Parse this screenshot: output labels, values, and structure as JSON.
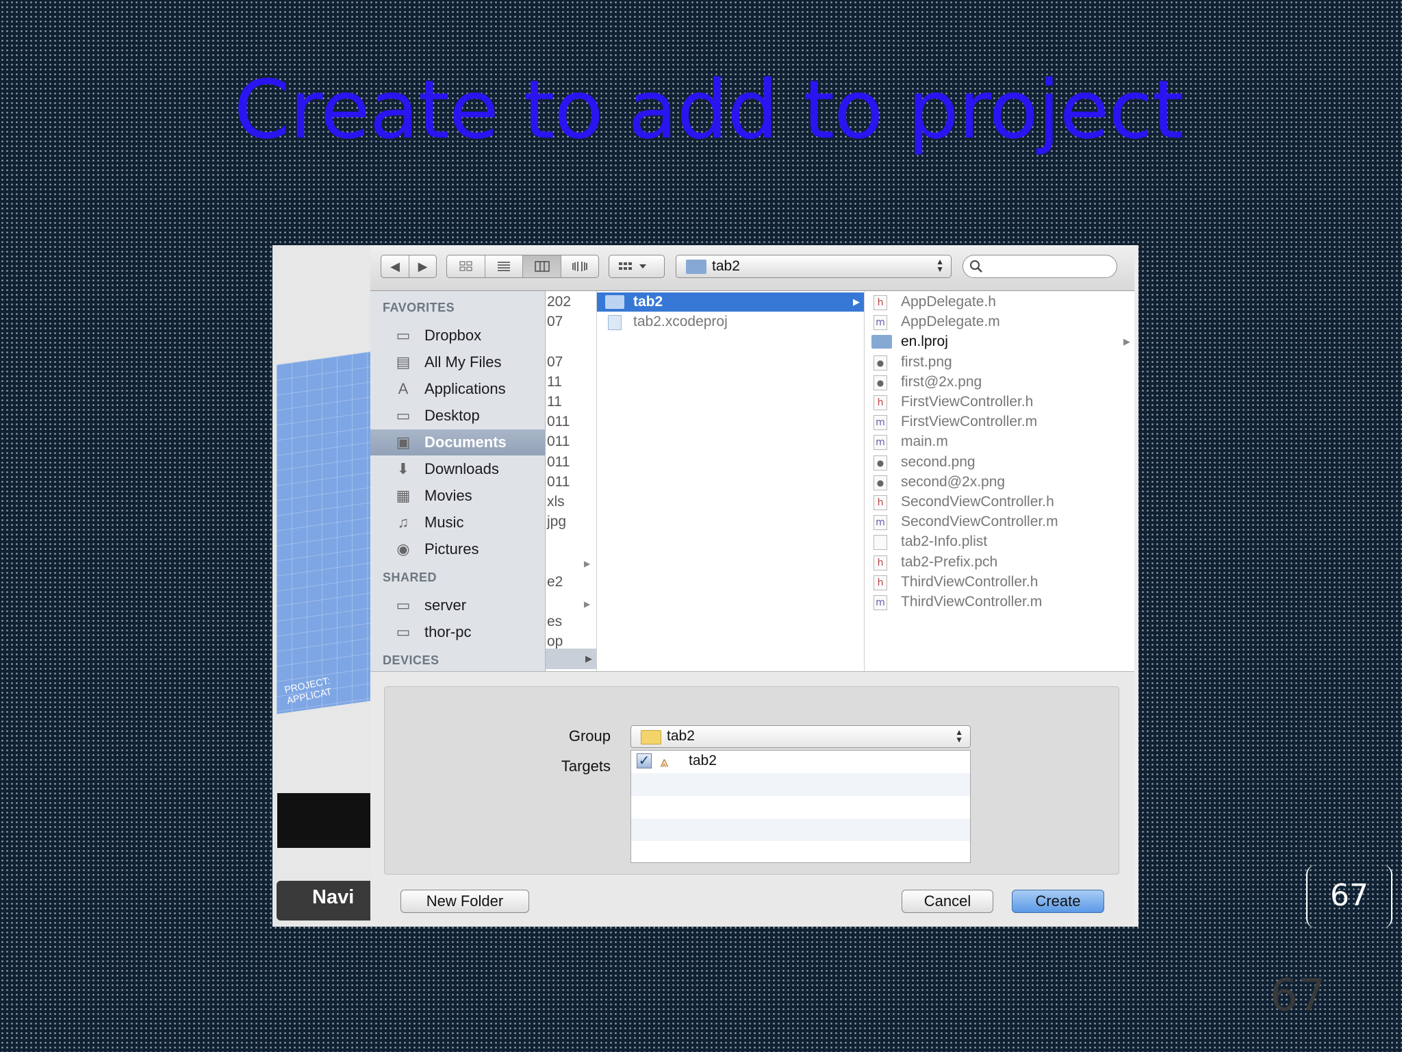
{
  "slide": {
    "title": "Create to add to project",
    "page_number": "67",
    "page_number_ghost": "67"
  },
  "background_app": {
    "nav_label": "Navi",
    "blueprint_label": "PROJECT: APPLICAT"
  },
  "toolbar": {
    "back_glyph": "◀",
    "forward_glyph": "▶",
    "path_popup": "tab2",
    "search_placeholder": ""
  },
  "sidebar": {
    "favorites_heading": "FAVORITES",
    "favorites": [
      {
        "label": "Dropbox",
        "icon": "folder-icon"
      },
      {
        "label": "All My Files",
        "icon": "all-files-icon"
      },
      {
        "label": "Applications",
        "icon": "applications-icon"
      },
      {
        "label": "Desktop",
        "icon": "desktop-icon"
      },
      {
        "label": "Documents",
        "icon": "documents-icon",
        "selected": true
      },
      {
        "label": "Downloads",
        "icon": "downloads-icon"
      },
      {
        "label": "Movies",
        "icon": "movies-icon"
      },
      {
        "label": "Music",
        "icon": "music-icon"
      },
      {
        "label": "Pictures",
        "icon": "pictures-icon"
      }
    ],
    "shared_heading": "SHARED",
    "shared": [
      {
        "label": "server",
        "icon": "computer-icon"
      },
      {
        "label": "thor-pc",
        "icon": "computer-icon"
      }
    ],
    "devices_heading": "DEVICES"
  },
  "column0": [
    "202",
    "07",
    "",
    "07",
    "11",
    "11",
    "011",
    "011",
    "011",
    "011",
    "xls",
    "jpg",
    "",
    "",
    "e2",
    "",
    "es",
    "op"
  ],
  "column1": [
    {
      "name": "tab2",
      "type": "folder",
      "selected": true
    },
    {
      "name": "tab2.xcodeproj",
      "type": "project"
    }
  ],
  "column2": [
    {
      "name": "AppDelegate.h",
      "kind": "h"
    },
    {
      "name": "AppDelegate.m",
      "kind": "m"
    },
    {
      "name": "en.lproj",
      "kind": "folder"
    },
    {
      "name": "first.png",
      "kind": "img"
    },
    {
      "name": "first@2x.png",
      "kind": "img"
    },
    {
      "name": "FirstViewController.h",
      "kind": "h"
    },
    {
      "name": "FirstViewController.m",
      "kind": "m"
    },
    {
      "name": "main.m",
      "kind": "m"
    },
    {
      "name": "second.png",
      "kind": "img"
    },
    {
      "name": "second@2x.png",
      "kind": "img"
    },
    {
      "name": "SecondViewController.h",
      "kind": "h"
    },
    {
      "name": "SecondViewController.m",
      "kind": "m"
    },
    {
      "name": "tab2-Info.plist",
      "kind": "plist"
    },
    {
      "name": "tab2-Prefix.pch",
      "kind": "h"
    },
    {
      "name": "ThirdViewController.h",
      "kind": "h"
    },
    {
      "name": "ThirdViewController.m",
      "kind": "m"
    }
  ],
  "options": {
    "group_label": "Group",
    "group_value": "tab2",
    "targets_label": "Targets",
    "target_name": "tab2",
    "target_checked": true
  },
  "buttons": {
    "new_folder": "New Folder",
    "cancel": "Cancel",
    "create": "Create"
  },
  "colors": {
    "title": "#2a14f0",
    "selection": "#3778d6",
    "slide_background": "#0f2133"
  }
}
